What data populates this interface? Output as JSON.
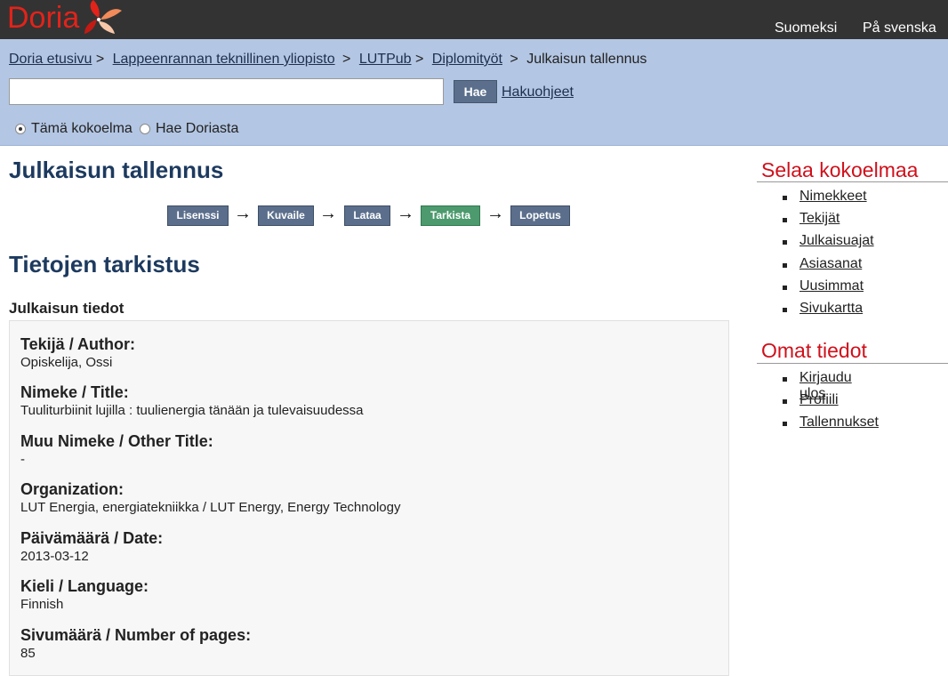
{
  "header": {
    "logo_text": "Doria",
    "lang_fi": "Suomeksi",
    "lang_sv": "På svenska",
    "brand_color": "#e2231a"
  },
  "breadcrumb": {
    "items": [
      "Doria etusivu",
      "Lappeenrannan teknillinen yliopisto",
      "LUTPub",
      "Diplomityöt"
    ],
    "current": "Julkaisun tallennus",
    "separator": ">"
  },
  "search": {
    "value": "",
    "placeholder": "",
    "button_label": "Hae",
    "help_link": "Hakuohjeet",
    "scope_options": [
      "Tämä kokoelma",
      "Hae Doriasta"
    ],
    "scope_selected": "Tämä kokoelma"
  },
  "main": {
    "title": "Julkaisun tallennus",
    "steps": [
      {
        "label": "Lisenssi",
        "active": false
      },
      {
        "label": "Kuvaile",
        "active": false
      },
      {
        "label": "Lataa",
        "active": false
      },
      {
        "label": "Tarkista",
        "active": true
      },
      {
        "label": "Lopetus",
        "active": false
      }
    ],
    "step_arrow": "→",
    "section_title": "Tietojen tarkistus",
    "subsection_title": "Julkaisun tiedot",
    "fields": [
      {
        "label": "Tekijä / Author:",
        "value": "Opiskelija, Ossi"
      },
      {
        "label": "Nimeke / Title:",
        "value": "Tuuliturbiinit lujilla : tuulienergia tänään ja tulevaisuudessa"
      },
      {
        "label": "Muu Nimeke / Other Title:",
        "value": "-"
      },
      {
        "label": "Organization:",
        "value": "LUT Energia, energiatekniikka / LUT Energy, Energy Technology"
      },
      {
        "label": "Päivämäärä / Date:",
        "value": "2013-03-12"
      },
      {
        "label": "Kieli / Language:",
        "value": "Finnish"
      },
      {
        "label": "Sivumäärä / Number of pages:",
        "value": "85"
      }
    ]
  },
  "sidebar": {
    "browse_title": "Selaa kokoelmaa",
    "browse_items": [
      "Nimekkeet",
      "Tekijät",
      "Julkaisuajat",
      "Asiasanat",
      "Uusimmat",
      "Sivukartta"
    ],
    "account_title": "Omat tiedot",
    "account_items": [
      "Kirjaudu ulos",
      "Profiili",
      "Tallennukset"
    ]
  }
}
